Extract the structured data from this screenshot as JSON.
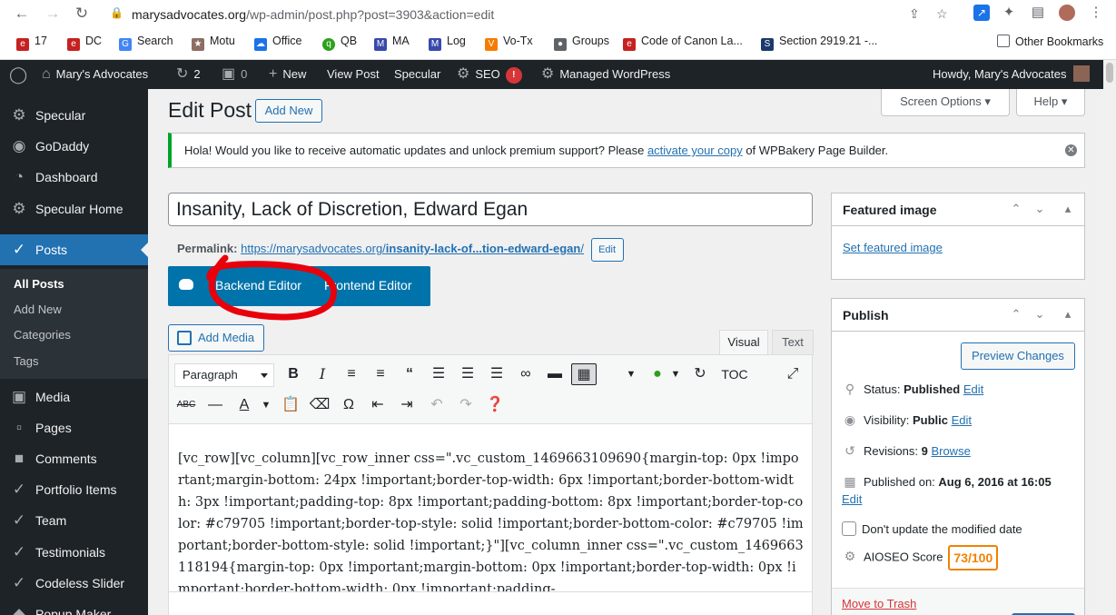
{
  "browser": {
    "url_domain": "marysadvocates.org",
    "url_path": "/wp-admin/post.php?post=3903&action=edit",
    "bookmarks": [
      {
        "label": "17",
        "icon_color": "#c5221f"
      },
      {
        "label": "DC",
        "icon_color": "#c5221f"
      },
      {
        "label": "Search",
        "icon_color": "#4285f4"
      },
      {
        "label": "Motu",
        "icon_color": "#8d6e63"
      },
      {
        "label": "Office",
        "icon_color": "#1a73e8"
      },
      {
        "label": "QB",
        "icon_color": "#2ca01c"
      },
      {
        "label": "MA",
        "icon_color": "#3949ab"
      },
      {
        "label": "Log",
        "icon_color": "#3949ab"
      },
      {
        "label": "Vo-Tx",
        "icon_color": "#f57c00"
      },
      {
        "label": "Groups",
        "icon_color": "#5f6368"
      },
      {
        "label": "Code of Canon La...",
        "icon_color": "#c5221f"
      },
      {
        "label": "Section 2919.21 -...",
        "icon_color": "#1a3a6b"
      }
    ],
    "other_bookmarks": "Other Bookmarks"
  },
  "adminbar": {
    "site_name": "Mary's Advocates",
    "updates_count": "2",
    "comments_count": "0",
    "new_label": "New",
    "view_post": "View Post",
    "specular": "Specular",
    "seo": "SEO",
    "seo_badge": "!",
    "managed_wp": "Managed WordPress",
    "howdy": "Howdy, Mary's Advocates"
  },
  "sidebar": {
    "items": [
      {
        "label": "Specular",
        "icon": "gear-icon"
      },
      {
        "label": "GoDaddy",
        "icon": "godaddy-icon"
      },
      {
        "label": "Dashboard",
        "icon": "dashboard-icon"
      },
      {
        "label": "Specular Home",
        "icon": "gear-icon"
      },
      {
        "label": "Posts",
        "icon": "pin-icon"
      },
      {
        "label": "Media",
        "icon": "media-icon"
      },
      {
        "label": "Pages",
        "icon": "pages-icon"
      },
      {
        "label": "Comments",
        "icon": "comment-icon"
      },
      {
        "label": "Portfolio Items",
        "icon": "pin-icon"
      },
      {
        "label": "Team",
        "icon": "pin-icon"
      },
      {
        "label": "Testimonials",
        "icon": "pin-icon"
      },
      {
        "label": "Codeless Slider",
        "icon": "pin-icon"
      },
      {
        "label": "Popup Maker",
        "icon": "popup-icon"
      }
    ],
    "submenu": [
      "All Posts",
      "Add New",
      "Categories",
      "Tags"
    ]
  },
  "main": {
    "title": "Edit Post",
    "add_new": "Add New",
    "screen_options": "Screen Options",
    "help": "Help",
    "notice_before": "Hola! Would you like to receive automatic updates and unlock premium support? Please ",
    "notice_link": "activate your copy",
    "notice_after": " of WPBakery Page Builder.",
    "post_title": "Insanity, Lack of Discretion, Edward Egan",
    "permalink_label": "Permalink:",
    "permalink_base": "https://marysadvocates.org/",
    "permalink_slug": "insanity-lack-of...tion-edward-egan",
    "permalink_trailing": "/",
    "permalink_edit": "Edit",
    "backend_editor": "Backend Editor",
    "frontend_editor": "Frontend Editor",
    "add_media": "Add Media",
    "tab_visual": "Visual",
    "tab_text": "Text",
    "format_select": "Paragraph",
    "toc": "TOC",
    "content": "[vc_row][vc_column][vc_row_inner css=\".vc_custom_1469663109690{margin-top: 0px !important;margin-bottom: 24px !important;border-top-width: 6px !important;border-bottom-width: 3px !important;padding-top: 8px !important;padding-bottom: 8px !important;border-top-color: #c79705 !important;border-top-style: solid !important;border-bottom-color: #c79705 !important;border-bottom-style: solid !important;}\"][vc_column_inner css=\".vc_custom_1469663118194{margin-top: 0px !important;margin-bottom: 0px !important;border-top-width: 0px !important;border-bottom-width: 0px !important;padding-"
  },
  "featured": {
    "title": "Featured image",
    "link": "Set featured image"
  },
  "publish": {
    "title": "Publish",
    "preview": "Preview Changes",
    "status_label": "Status:",
    "status_value": "Published",
    "visibility_label": "Visibility:",
    "visibility_value": "Public",
    "revisions_label": "Revisions:",
    "revisions_value": "9",
    "browse": "Browse",
    "published_label": "Published on:",
    "published_value": "Aug 6, 2016 at 16:05",
    "edit": "Edit",
    "dont_update": "Don't update the modified date",
    "aioseo_label": "AIOSEO Score",
    "aioseo_score": "73/100",
    "trash": "Move to Trash"
  },
  "colors": {
    "wp_blue": "#2271b1",
    "wpb_blue": "#0073aa",
    "admin_dark": "#1d2327",
    "notice_green": "#00a32a",
    "annotation_red": "#e8000b",
    "score_orange": "#f18200"
  }
}
